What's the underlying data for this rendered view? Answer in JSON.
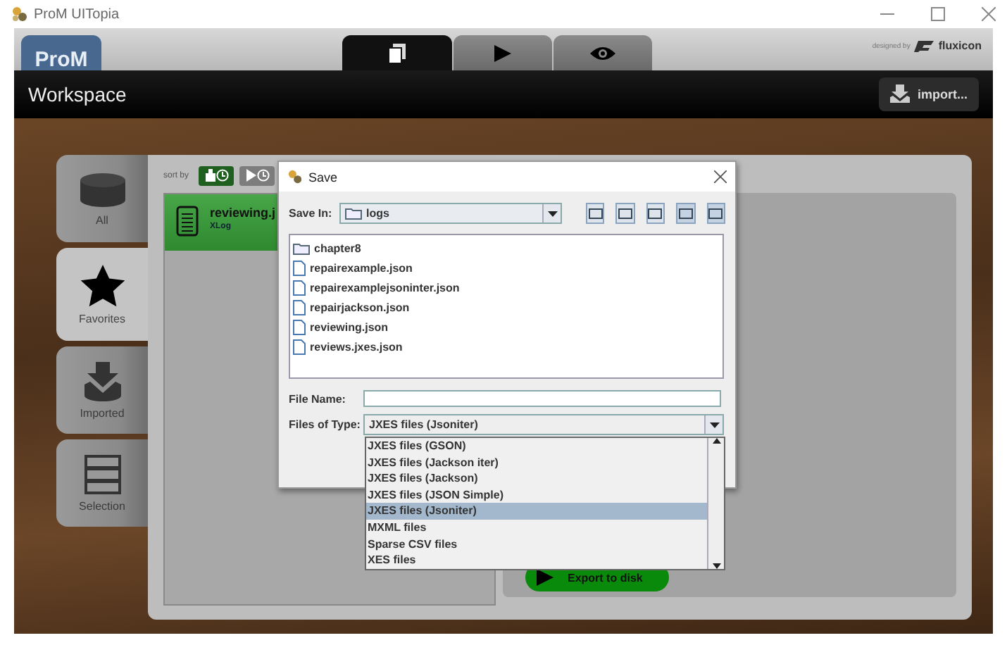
{
  "window": {
    "title": "ProM UITopia"
  },
  "header": {
    "logo": "ProM",
    "credit": "designed by",
    "brand": "fluxicon",
    "tabs": [
      {
        "kind": "workspace",
        "selected": true
      },
      {
        "kind": "run",
        "selected": false
      },
      {
        "kind": "view",
        "selected": false
      }
    ]
  },
  "toolbar": {
    "title": "Workspace",
    "import_button": "import..."
  },
  "side_tabs": [
    {
      "label": "All",
      "kind": "all",
      "selected": false
    },
    {
      "label": "Favorites",
      "kind": "favorites",
      "selected": true
    },
    {
      "label": "Imported",
      "kind": "imported",
      "selected": false
    },
    {
      "label": "Selection",
      "kind": "selection",
      "selected": false
    }
  ],
  "sort": {
    "label": "sort by",
    "options": [
      {
        "kind": "name",
        "selected": true
      },
      {
        "kind": "time",
        "selected": false
      }
    ]
  },
  "resources": [
    {
      "name": "reviewing.j",
      "type": "XLog",
      "selected": true
    }
  ],
  "export_button": "Export to disk",
  "dialog": {
    "title": "Save",
    "save_in_label": "Save In:",
    "save_in_value": "logs",
    "files": [
      {
        "name": "chapter8",
        "kind": "folder"
      },
      {
        "name": "repairexample.json",
        "kind": "file"
      },
      {
        "name": "repairexamplejsoninter.json",
        "kind": "file"
      },
      {
        "name": "repairjackson.json",
        "kind": "file"
      },
      {
        "name": "reviewing.json",
        "kind": "file"
      },
      {
        "name": "reviews.jxes.json",
        "kind": "file"
      }
    ],
    "file_name_label": "File Name:",
    "type_label": "Files of Type:",
    "type_value": "JXES files (Jsoniter)",
    "type_options": [
      {
        "label": "JXES files (GSON)",
        "selected": false
      },
      {
        "label": "JXES files (Jackson iter)",
        "selected": false
      },
      {
        "label": "JXES files (Jackson)",
        "selected": false
      },
      {
        "label": "JXES files (JSON Simple)",
        "selected": false
      },
      {
        "label": "JXES files (Jsoniter)",
        "selected": true
      },
      {
        "label": "MXML files",
        "selected": false
      },
      {
        "label": "Sparse CSV files",
        "selected": false
      },
      {
        "label": "XES files",
        "selected": false
      }
    ]
  }
}
